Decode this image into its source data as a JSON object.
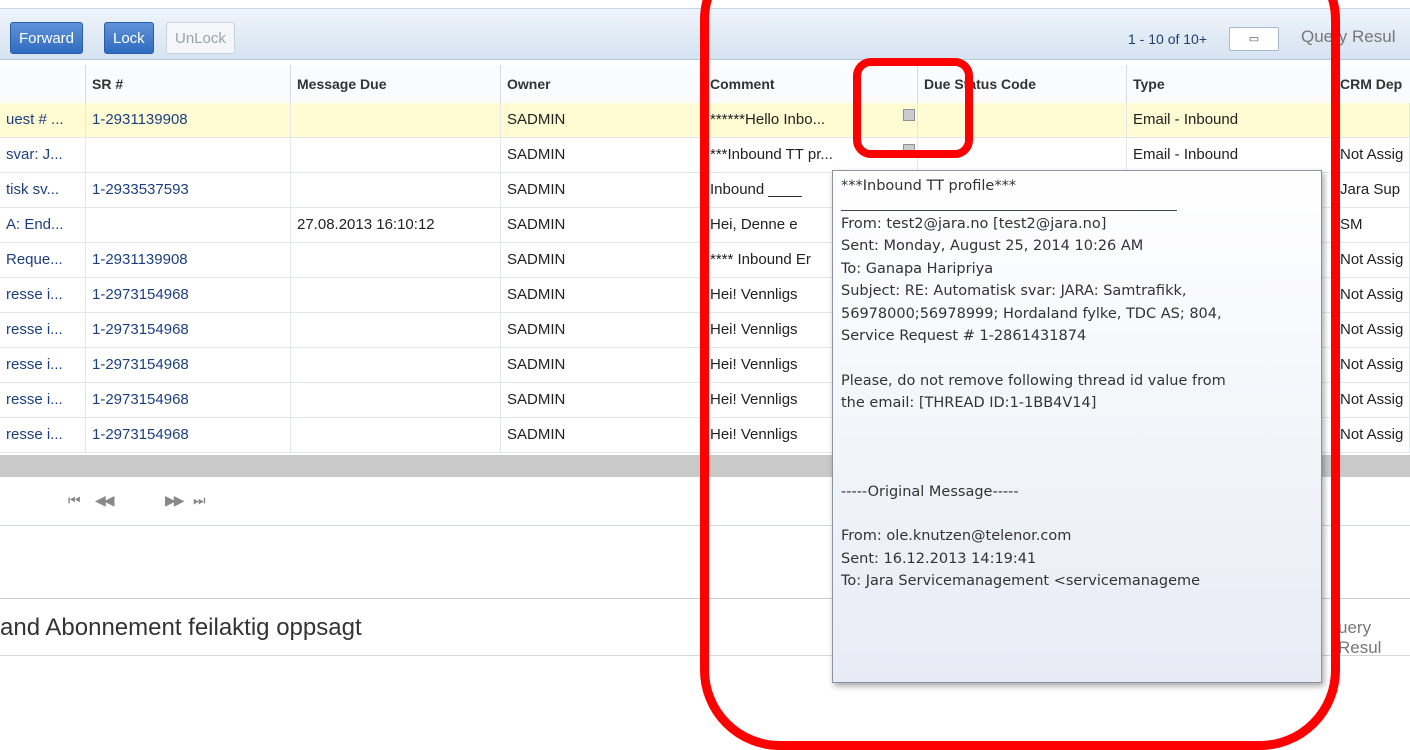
{
  "toolbar": {
    "buttons": [
      {
        "label": "Forward",
        "state": "active"
      },
      {
        "label": "Lock",
        "state": "active"
      },
      {
        "label": "UnLock",
        "state": "disabled"
      }
    ],
    "record_count": "1 - 10 of 10+",
    "query_label": "Query Resul"
  },
  "grid": {
    "columns": [
      "SR #",
      "Message Due",
      "Owner",
      "Comment",
      "Due Status Code",
      "Type",
      "CRM Dep"
    ],
    "rows": [
      {
        "subject": "uest # ...",
        "sr": "1-2931139908",
        "due": "",
        "owner": "SADMIN",
        "comment": "******Hello Inbo...",
        "type": "Email - Inbound",
        "crm": ""
      },
      {
        "subject": "svar: J...",
        "sr": "",
        "due": "",
        "owner": "SADMIN",
        "comment": "***Inbound TT pr...",
        "type": "Email - Inbound",
        "crm": "Not Assig"
      },
      {
        "subject": "tisk sv...",
        "sr": "1-2933537593",
        "due": "",
        "owner": "SADMIN",
        "comment": "Inbound ____",
        "type": "",
        "crm": "Jara Sup"
      },
      {
        "subject": "A: End...",
        "sr": "",
        "due": "27.08.2013 16:10:12",
        "owner": "SADMIN",
        "comment": "Hei,   Denne e",
        "type": "",
        "crm": "SM"
      },
      {
        "subject": "Reque...",
        "sr": "1-2931139908",
        "due": "",
        "owner": "SADMIN",
        "comment": "**** Inbound Er",
        "type": "",
        "crm": "Not Assig"
      },
      {
        "subject": "resse i...",
        "sr": "1-2973154968",
        "due": "",
        "owner": "SADMIN",
        "comment": "Hei!   Vennligs",
        "type": "",
        "crm": "Not Assig"
      },
      {
        "subject": "resse i...",
        "sr": "1-2973154968",
        "due": "",
        "owner": "SADMIN",
        "comment": "Hei!   Vennligs",
        "type": "",
        "crm": "Not Assig"
      },
      {
        "subject": "resse i...",
        "sr": "1-2973154968",
        "due": "",
        "owner": "SADMIN",
        "comment": "Hei!   Vennligs",
        "type": "",
        "crm": "Not Assig"
      },
      {
        "subject": "resse i...",
        "sr": "1-2973154968",
        "due": "",
        "owner": "SADMIN",
        "comment": "Hei!   Vennligs",
        "type": "",
        "crm": "Not Assig"
      },
      {
        "subject": "resse i...",
        "sr": "1-2973154968",
        "due": "",
        "owner": "SADMIN",
        "comment": "Hei!   Vennligs",
        "type": "",
        "crm": "Not Assig"
      }
    ]
  },
  "pager_nav": {
    "first": "⏮",
    "prev": "◀◀",
    "next": "▶▶",
    "last": "⏭"
  },
  "bottom": {
    "title": "and Abonnement feilaktig oppsagt",
    "query_label": "uery Resul"
  },
  "tooltip": {
    "title": "***Inbound TT profile***",
    "from": "From: test2@jara.no [test2@jara.no]",
    "sent": "Sent: Monday, August 25, 2014 10:26 AM",
    "to": "To: Ganapa Haripriya",
    "subject_1": "Subject: RE: Automatisk svar: JARA: Samtrafikk,",
    "subject_2": "56978000;56978999; Hordaland fylke, TDC AS; 804,",
    "subject_3": "Service Request # 1-2861431874",
    "please_1": "Please, do not remove following thread id value from",
    "please_2": "the email: [THREAD ID:1-1BB4V14]",
    "original": "-----Original Message-----",
    "orig_from": "From:  ole.knutzen@telenor.com",
    "orig_sent": "Sent:  16.12.2013 14:19:41",
    "orig_to": "To:  Jara Servicemanagement <servicemanageme"
  },
  "colors": {
    "annotation": "#ff0000",
    "selected_row": "#fffbd2",
    "button_active": "#2f6bbf"
  }
}
